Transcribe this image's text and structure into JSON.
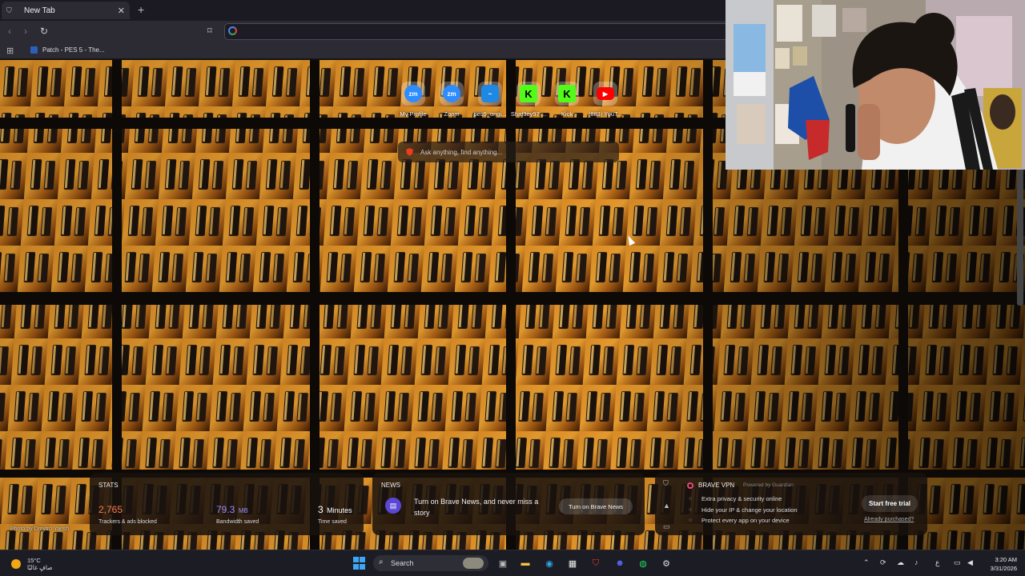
{
  "browser": {
    "tab_title": "New Tab",
    "bookmark_label": "Patch - PES 5 - The...",
    "omnibox_value": ""
  },
  "top_sites": [
    {
      "label": "My Profile",
      "glyph": "zm",
      "color": "#2d8cff"
    },
    {
      "label": "Zoom",
      "glyph": "zm",
      "color": "#2d8cff"
    },
    {
      "label": "pes5_origi...",
      "glyph": "~",
      "color": "#1e88e5"
    },
    {
      "label": "Shaf3ey97 ...",
      "glyph": "K",
      "color": "#53fc18"
    },
    {
      "label": "Kick",
      "glyph": "K",
      "color": "#53fc18"
    },
    {
      "label": "(883) YouT...",
      "glyph": "▶",
      "color": "#ff0000"
    }
  ],
  "search": {
    "placeholder": "Ask anything, find anything..."
  },
  "photo_credit": "Photo by Dmytro Yarish",
  "stats": {
    "heading": "STATS",
    "trackers_value": "2,765",
    "trackers_label": "Trackers & ads blocked",
    "bandwidth_value": "79.3",
    "bandwidth_unit": "MB",
    "bandwidth_label": "Bandwidth saved",
    "time_value": "3",
    "time_unit": "Minutes",
    "time_label": "Time saved",
    "colors": {
      "trackers": "#ff7a4a",
      "bandwidth": "#9b8cf5",
      "time": "#ffffff"
    }
  },
  "news": {
    "heading": "NEWS",
    "text": "Turn on Brave News, and never miss a story",
    "button": "Turn on Brave News"
  },
  "vpn": {
    "title": "BRAVE VPN",
    "powered_by": "Powered by Guardian",
    "features": [
      "Extra privacy & security online",
      "Hide your IP & change your location",
      "Protect every app on your device"
    ],
    "trial_button": "Start free trial",
    "purchased_link": "Already purchased?"
  },
  "taskbar": {
    "temperature": "15°C",
    "weather_text": "صافٍ غالبًا",
    "search_label": "Search",
    "time": "3:20 AM",
    "date": "3/31/2026",
    "lang": "ع"
  }
}
